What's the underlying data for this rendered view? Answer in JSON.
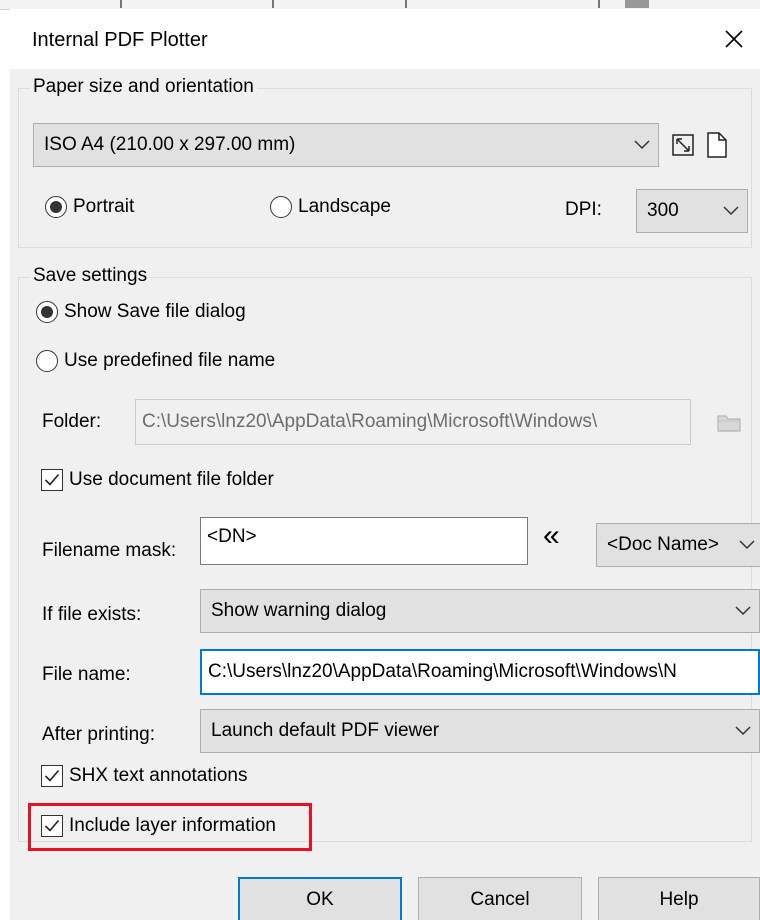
{
  "dialog": {
    "title": "Internal PDF Plotter",
    "close_icon": "close-icon"
  },
  "paper": {
    "legend": "Paper size and orientation",
    "size_value": "ISO A4 (210.00 x 297.00 mm)",
    "orientation_options": [
      "Portrait",
      "Landscape"
    ],
    "orientation_selected": "Portrait",
    "dpi_label": "DPI:",
    "dpi_value": "300"
  },
  "save": {
    "legend": "Save settings",
    "mode_options": [
      "Show Save file dialog",
      "Use predefined file name"
    ],
    "mode_selected": "Show Save file dialog",
    "folder_label": "Folder:",
    "folder_value": "C:\\Users\\lnz20\\AppData\\Roaming\\Microsoft\\Windows\\",
    "use_doc_folder_label": "Use document file folder",
    "use_doc_folder_checked": true,
    "filename_mask_label": "Filename mask:",
    "filename_mask_value": "<DN>",
    "insert_macro_symbol": "«",
    "macro_value": "<Doc Name>",
    "if_exists_label": "If file exists:",
    "if_exists_value": "Show warning dialog",
    "file_name_label": "File name:",
    "file_name_value": "C:\\Users\\lnz20\\AppData\\Roaming\\Microsoft\\Windows\\N",
    "after_printing_label": "After printing:",
    "after_printing_value": "Launch default PDF viewer",
    "shx_label": "SHX text annotations",
    "shx_checked": true,
    "layer_info_label": "Include layer information",
    "layer_info_checked": true,
    "highlight_color": "#e81123"
  },
  "buttons": {
    "ok": "OK",
    "cancel": "Cancel",
    "help": "Help"
  },
  "colors": {
    "dialog_bg": "#f0f0f0",
    "focus_accent": "#0078d7"
  }
}
